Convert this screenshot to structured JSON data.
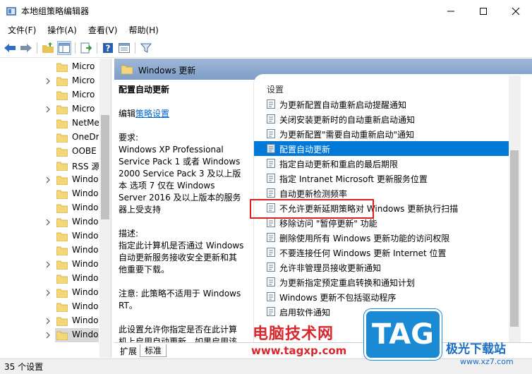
{
  "window": {
    "title": "本地组策略编辑器",
    "minimize_icon": "minimize-icon",
    "maximize_icon": "maximize-icon",
    "close_icon": "close-icon"
  },
  "menu": [
    "文件(F)",
    "操作(A)",
    "查看(V)",
    "帮助(H)"
  ],
  "toolbar": {
    "icons": [
      "back-arrow-icon",
      "forward-arrow-icon",
      "up-folder-icon",
      "show-hide-tree-icon",
      "export-list-icon",
      "help-icon",
      "properties-icon",
      "filter-icon"
    ]
  },
  "tree": {
    "items": [
      {
        "label": "Micro",
        "has_chevron": false
      },
      {
        "label": "Micro",
        "has_chevron": true
      },
      {
        "label": "Micro",
        "has_chevron": false
      },
      {
        "label": "Micro",
        "has_chevron": true
      },
      {
        "label": "NetMe",
        "has_chevron": false
      },
      {
        "label": "OneDr",
        "has_chevron": false
      },
      {
        "label": "OOBE",
        "has_chevron": false
      },
      {
        "label": "RSS 源",
        "has_chevron": false
      },
      {
        "label": "Windo",
        "has_chevron": true
      },
      {
        "label": "Windo",
        "has_chevron": false
      },
      {
        "label": "Windo",
        "has_chevron": false
      },
      {
        "label": "Windo",
        "has_chevron": true
      },
      {
        "label": "Windo",
        "has_chevron": false
      },
      {
        "label": "Windo",
        "has_chevron": false
      },
      {
        "label": "Windo",
        "has_chevron": true
      },
      {
        "label": "Windo",
        "has_chevron": false
      },
      {
        "label": "Windo",
        "has_chevron": true
      },
      {
        "label": "Windo",
        "has_chevron": false
      },
      {
        "label": "Windo",
        "has_chevron": true
      },
      {
        "label": "Windo",
        "has_chevron": true,
        "selected": true
      }
    ]
  },
  "header": {
    "folder_title": "Windows 更新"
  },
  "description": {
    "title": "配置自动更新",
    "edit_prefix": "编辑",
    "edit_link": "策略设置",
    "requirements_label": "要求:",
    "requirements_text": "Windows XP Professional Service Pack 1 或者 Windows 2000 Service Pack 3 及以上版本 选项 7 仅在 Windows Server 2016 及以上版本的服务器上受支持",
    "desc_label": "描述:",
    "desc_text": "指定此计算机是否通过 Windows 自动更新服务接收安全更新和其他重要下载。",
    "note_text": "注意: 此策略不适用于 Windows RT。",
    "more_text": "此设置允许你指定是否在此计算机上启用自动更新。如果启用该服"
  },
  "settings": {
    "column_header": "设置",
    "items": [
      "为更新配置自动重新启动提醒通知",
      "关闭安装更新时的自动重新启动通知",
      "为更新配置\"需要自动重新启动\"通知",
      "配置自动更新",
      "指定自动更新和重启的最后期限",
      "指定 Intranet Microsoft 更新服务位置",
      "自动更新检测频率",
      "不允许更新延期策略对 Windows 更新执行扫描",
      "移除访问 \"暂停更新\" 功能",
      "删除使用所有 Windows 更新功能的访问权限",
      "不要连接任何 Windows 更新 Internet 位置",
      "允许非管理员接收更新通知",
      "为更新指定预定重启转换和通知计划",
      "Windows 更新不包括驱动程序",
      "启用软件通知"
    ],
    "selected_index": 3
  },
  "tabs": [
    "扩展",
    "标准"
  ],
  "status": {
    "text": "35 个设置"
  },
  "watermark": {
    "site_cn": "电脑技术网",
    "site_url": "www.tagxp.com",
    "tag_logo": "TAG",
    "brand2": "极光下载站",
    "brand2_url": "www.xz7.com"
  },
  "colors": {
    "selection": "#0078d7",
    "header_gradient_top": "#9fb8d8",
    "header_gradient_bottom": "#7e9dc6",
    "highlight_box": "#e02020",
    "link": "#0066cc"
  }
}
